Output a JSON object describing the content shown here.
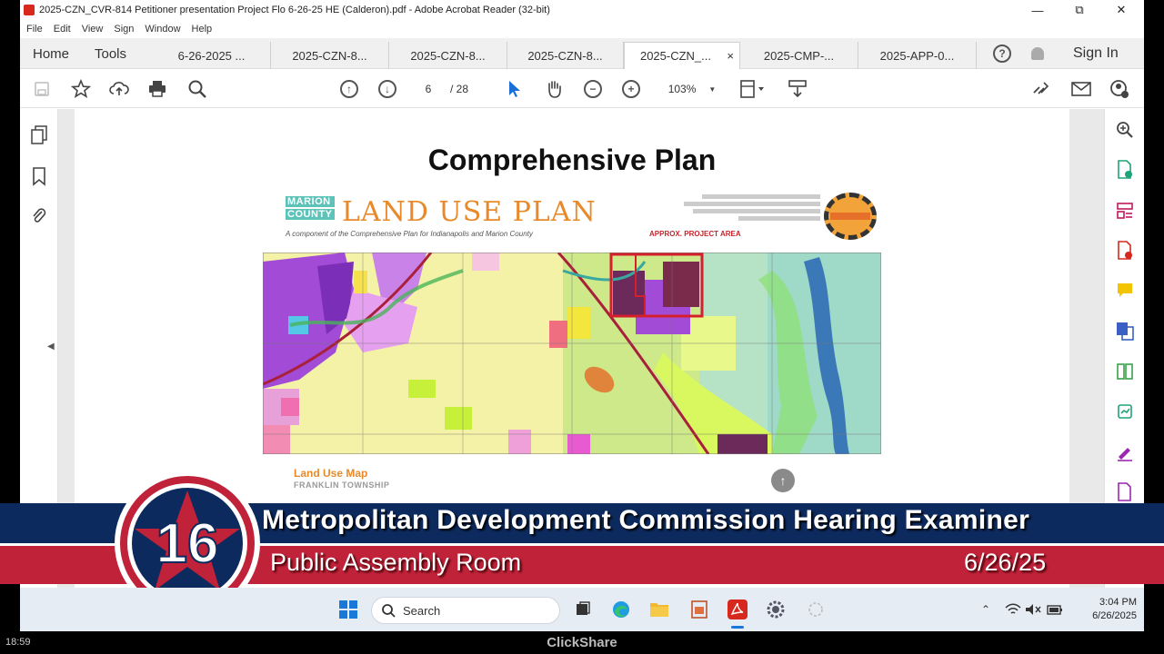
{
  "window": {
    "title": "2025-CZN_CVR-814 Petitioner presentation Project Flo 6-26-25 HE (Calderon).pdf - Adobe Acrobat Reader (32-bit)",
    "minimize": "—",
    "restore": "⧉",
    "close": "✕"
  },
  "menu": [
    "File",
    "Edit",
    "View",
    "Sign",
    "Window",
    "Help"
  ],
  "nav": {
    "home": "Home",
    "tools": "Tools"
  },
  "tabs": [
    {
      "label": "6-26-2025 ..."
    },
    {
      "label": "2025-CZN-8..."
    },
    {
      "label": "2025-CZN-8..."
    },
    {
      "label": "2025-CZN-8..."
    },
    {
      "label": "2025-CZN_...",
      "active": true,
      "close": "×"
    },
    {
      "label": "2025-CMP-..."
    },
    {
      "label": "2025-APP-0..."
    }
  ],
  "tabbar_right": {
    "help": "?",
    "sign_in": "Sign In"
  },
  "toolbar": {
    "page_current": "6",
    "page_total": "/ 28",
    "zoom": "103%"
  },
  "slide": {
    "title": "Comprehensive Plan",
    "county_line1": "MARION",
    "county_line2": "COUNTY",
    "plan_title": "LAND USE PLAN",
    "plan_subtitle": "A component of the Comprehensive Plan for Indianapolis and Marion County",
    "approx_label": "APPROX. PROJECT AREA",
    "map_caption": "Land Use Map",
    "township": "FRANKLIN TOWNSHIP"
  },
  "banner": {
    "channel": "16",
    "title": "Metropolitan Development Commission Hearing Examiner",
    "room": "Public Assembly Room",
    "date": "6/26/25"
  },
  "taskbar": {
    "search": "Search",
    "time": "3:04 PM",
    "date": "6/26/2025"
  },
  "bottom": {
    "elapsed": "18:59",
    "brand": "ClickShare"
  },
  "colors": {
    "banner_blue": "#0d2a5e",
    "banner_red": "#c0223a",
    "plan_orange": "#e88a2a",
    "project_outline": "#d61f2c"
  }
}
